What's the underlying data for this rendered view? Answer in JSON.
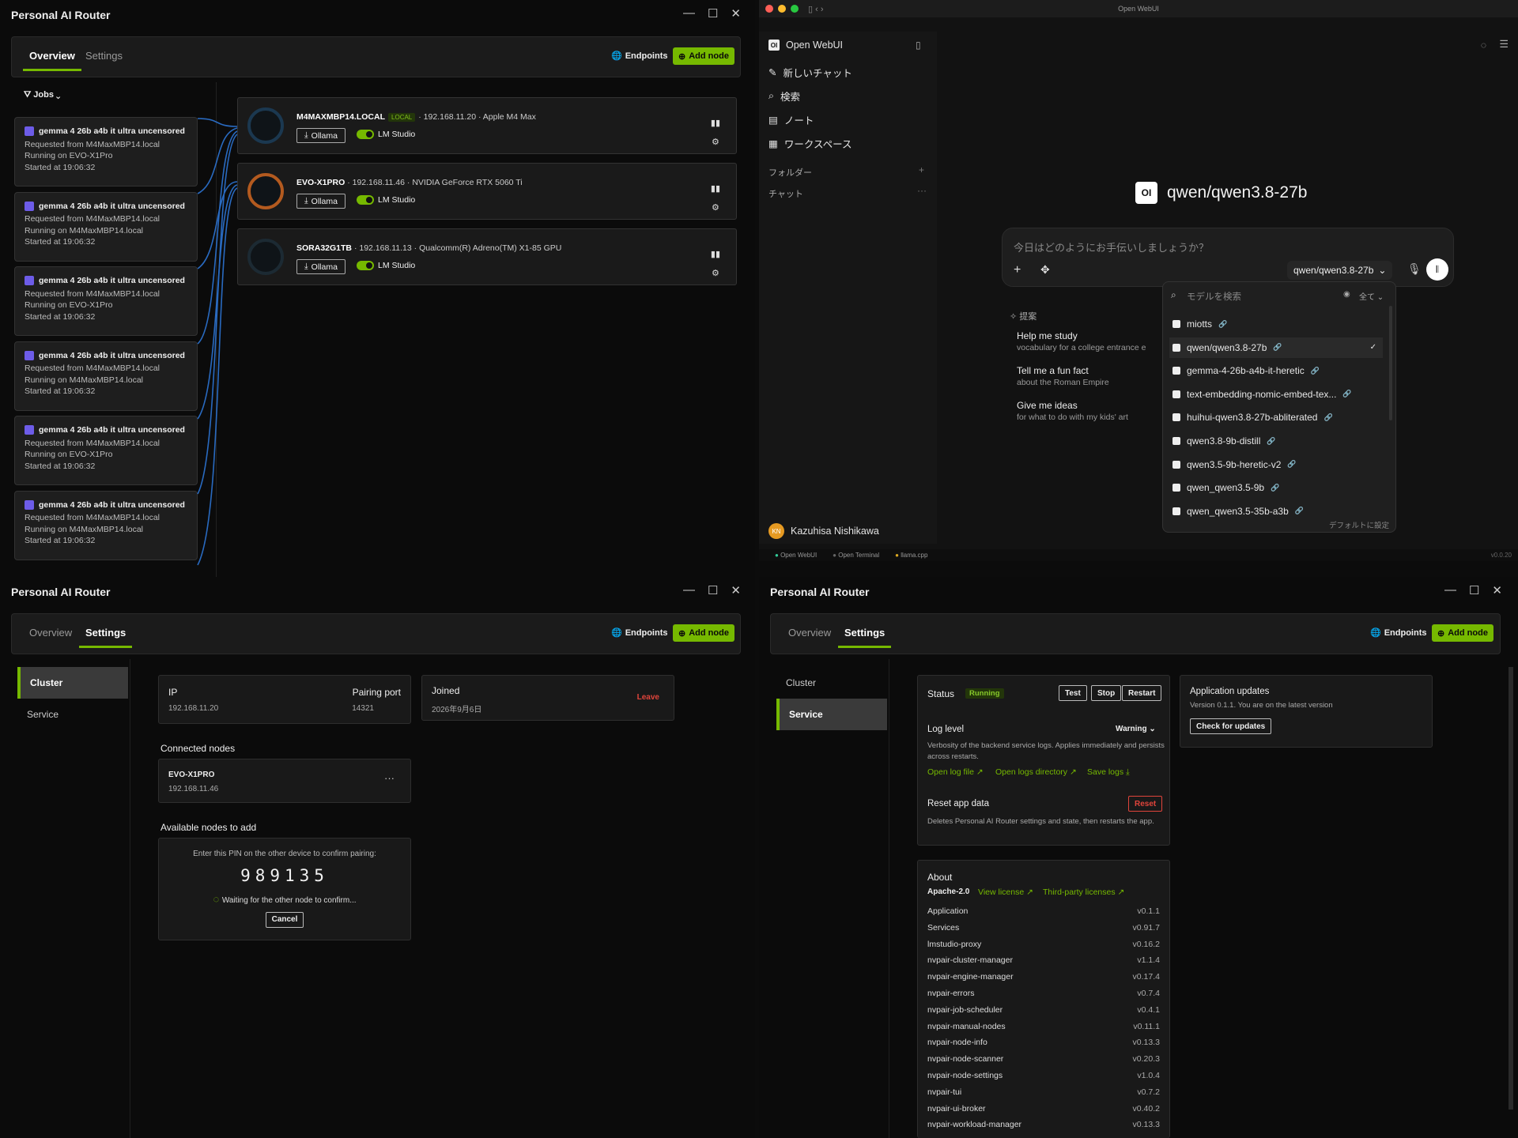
{
  "router": {
    "title": "Personal AI Router",
    "tabs": {
      "overview": "Overview",
      "settings": "Settings"
    },
    "endpoints": "Endpoints",
    "add_node": "Add node",
    "window_controls": {
      "min": "—",
      "max": "☐",
      "close": "✕"
    }
  },
  "overview": {
    "jobs_filter": "Jobs",
    "jobs": [
      {
        "title": "gemma 4 26b a4b it ultra uncensored h...",
        "from": "Requested from M4MaxMBP14.local",
        "on": "Running on EVO-X1Pro",
        "start": "Started at 19:06:32"
      },
      {
        "title": "gemma 4 26b a4b it ultra uncensored h...",
        "from": "Requested from M4MaxMBP14.local",
        "on": "Running on M4MaxMBP14.local",
        "start": "Started at 19:06:32"
      },
      {
        "title": "gemma 4 26b a4b it ultra uncensored h...",
        "from": "Requested from M4MaxMBP14.local",
        "on": "Running on EVO-X1Pro",
        "start": "Started at 19:06:32"
      },
      {
        "title": "gemma 4 26b a4b it ultra uncensored h...",
        "from": "Requested from M4MaxMBP14.local",
        "on": "Running on M4MaxMBP14.local",
        "start": "Started at 19:06:32"
      },
      {
        "title": "gemma 4 26b a4b it ultra uncensored h...",
        "from": "Requested from M4MaxMBP14.local",
        "on": "Running on EVO-X1Pro",
        "start": "Started at 19:06:32"
      },
      {
        "title": "gemma 4 26b a4b it ultra uncensored h...",
        "from": "Requested from M4MaxMBP14.local",
        "on": "Running on M4MaxMBP14.local",
        "start": "Started at 19:06:32"
      }
    ],
    "nodes": [
      {
        "name": "M4MAXMBP14.LOCAL",
        "badge": "LOCAL",
        "meta": "· 192.168.11.20 · Apple M4 Max",
        "ollama": "Ollama",
        "lm": "LM Studio"
      },
      {
        "name": "EVO-X1PRO",
        "badge": "",
        "meta": "· 192.168.11.46 · NVIDIA GeForce RTX 5060 Ti",
        "ollama": "Ollama",
        "lm": "LM Studio"
      },
      {
        "name": "SORA32G1TB",
        "badge": "",
        "meta": "· 192.168.11.13 · Qualcomm(R) Adreno(TM) X1-85 GPU",
        "ollama": "Ollama",
        "lm": "LM Studio"
      }
    ]
  },
  "webui": {
    "window_title": "Open WebUI",
    "brand": "Open WebUI",
    "nav": [
      "新しいチャット",
      "検索",
      "ノート",
      "ワークスペース"
    ],
    "folders": "フォルダー",
    "chats": "チャット",
    "model_heading": "qwen/qwen3.8-27b",
    "prompt_placeholder": "今日はどのようにお手伝いしましょうか？",
    "selected_model": "qwen/qwen3.8-27b",
    "suggest_label": "提案",
    "suggestions": [
      {
        "title": "Help me study",
        "sub": "vocabulary for a college entrance e"
      },
      {
        "title": "Tell me a fun fact",
        "sub": "about the Roman Empire"
      },
      {
        "title": "Give me ideas",
        "sub": "for what to do with my kids' art"
      }
    ],
    "search_placeholder": "モデルを検索",
    "filter_all": "全て",
    "models": [
      "miotts",
      "qwen/qwen3.8-27b",
      "gemma-4-26b-a4b-it-heretic",
      "text-embedding-nomic-embed-tex...",
      "huihui-qwen3.8-27b-abliterated",
      "qwen3.8-9b-distill",
      "qwen3.5-9b-heretic-v2",
      "qwen_qwen3.5-9b",
      "qwen_qwen3.5-35b-a3b"
    ],
    "set_default": "デフォルトに設定",
    "user_initials": "KN",
    "user_name": "Kazuhisa Nishikawa",
    "status_items": [
      "Open WebUI",
      "Open Terminal",
      "llama.cpp"
    ],
    "version": "v0.0.20"
  },
  "cluster": {
    "nav": {
      "cluster": "Cluster",
      "service": "Service"
    },
    "ip_label": "IP",
    "ip_value": "192.168.11.20",
    "port_label": "Pairing port",
    "port_value": "14321",
    "joined_label": "Joined",
    "joined_value": "2026年9月6日",
    "leave": "Leave",
    "connected_title": "Connected nodes",
    "connected_name": "EVO-X1PRO",
    "connected_ip": "192.168.11.46",
    "available_title": "Available nodes to add",
    "pin_prompt": "Enter this PIN on the other device to confirm pairing:",
    "pin": "989135",
    "waiting": "Waiting for the other node to confirm...",
    "cancel": "Cancel"
  },
  "service": {
    "status_label": "Status",
    "status_value": "Running",
    "test": "Test",
    "stop": "Stop",
    "restart": "Restart",
    "log_label": "Log level",
    "log_value": "Warning",
    "log_desc": "Verbosity of the backend service logs. Applies immediately and persists across restarts.",
    "open_log": "Open log file",
    "open_dir": "Open logs directory",
    "save_logs": "Save logs",
    "reset_label": "Reset app data",
    "reset_btn": "Reset",
    "reset_desc": "Deletes Personal AI Router settings and state, then restarts the app.",
    "updates_title": "Application updates",
    "updates_desc": "Version 0.1.1. You are on the latest version",
    "check_updates": "Check for updates",
    "about_title": "About",
    "license": "Apache-2.0",
    "view_license": "View license",
    "third_party": "Third-party licenses",
    "versions": [
      {
        "name": "Application",
        "v": "v0.1.1"
      },
      {
        "name": "Services",
        "v": "v0.91.7"
      },
      {
        "name": "lmstudio-proxy",
        "v": "v0.16.2"
      },
      {
        "name": "nvpair-cluster-manager",
        "v": "v1.1.4"
      },
      {
        "name": "nvpair-engine-manager",
        "v": "v0.17.4"
      },
      {
        "name": "nvpair-errors",
        "v": "v0.7.4"
      },
      {
        "name": "nvpair-job-scheduler",
        "v": "v0.4.1"
      },
      {
        "name": "nvpair-manual-nodes",
        "v": "v0.11.1"
      },
      {
        "name": "nvpair-node-info",
        "v": "v0.13.3"
      },
      {
        "name": "nvpair-node-scanner",
        "v": "v0.20.3"
      },
      {
        "name": "nvpair-node-settings",
        "v": "v1.0.4"
      },
      {
        "name": "nvpair-tui",
        "v": "v0.7.2"
      },
      {
        "name": "nvpair-ui-broker",
        "v": "v0.40.2"
      },
      {
        "name": "nvpair-workload-manager",
        "v": "v0.13.3"
      }
    ]
  }
}
